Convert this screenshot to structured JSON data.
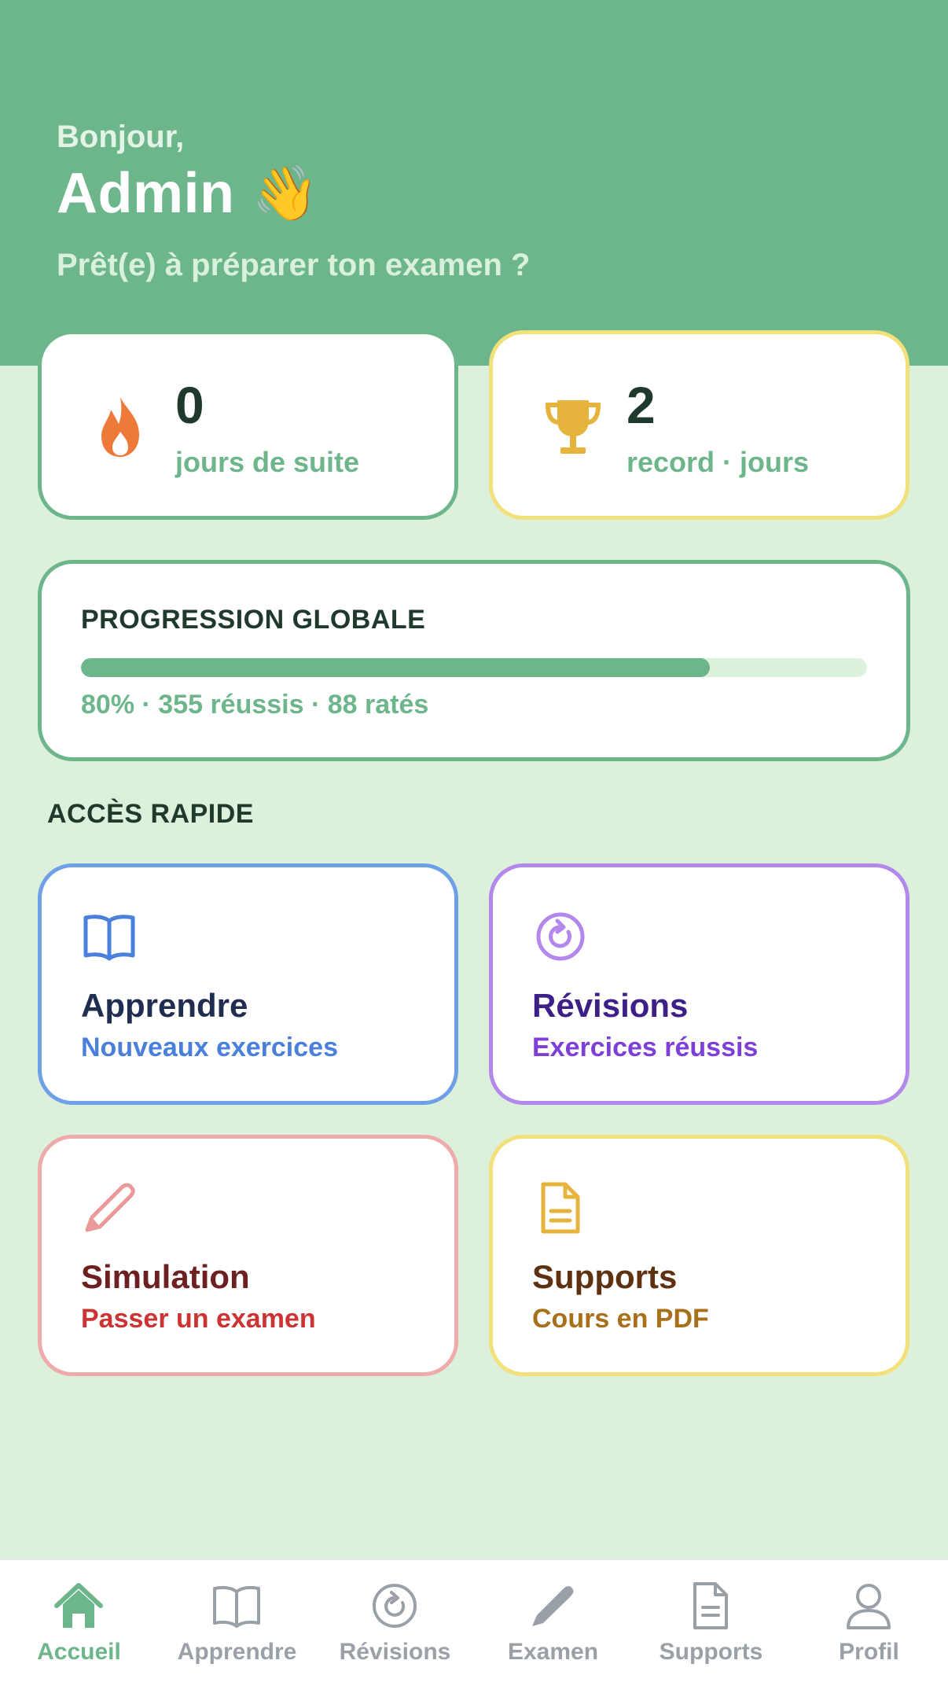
{
  "header": {
    "greeting": "Bonjour,",
    "username": "Admin",
    "wave_emoji": "👋",
    "subtitle": "Prêt(e) à préparer ton examen ?"
  },
  "stats": {
    "streak": {
      "value": "0",
      "label": "jours de suite",
      "icon": "flame-icon"
    },
    "record": {
      "value": "2",
      "label": "record · jours",
      "icon": "trophy-icon"
    }
  },
  "progress": {
    "title": "PROGRESSION GLOBALE",
    "percent": 80,
    "summary": "80% · 355 réussis · 88 ratés"
  },
  "quick_access": {
    "title": "ACCÈS RAPIDE",
    "items": [
      {
        "title": "Apprendre",
        "subtitle": "Nouveaux exercices",
        "icon": "book-icon",
        "color": "#6ea0e8"
      },
      {
        "title": "Révisions",
        "subtitle": "Exercices réussis",
        "icon": "refresh-icon",
        "color": "#b388ec"
      },
      {
        "title": "Simulation",
        "subtitle": "Passer un examen",
        "icon": "pencil-icon",
        "color": "#eeabab"
      },
      {
        "title": "Supports",
        "subtitle": "Cours en PDF",
        "icon": "document-icon",
        "color": "#f2e07a"
      }
    ]
  },
  "bottom_nav": {
    "active": "Accueil",
    "items": [
      {
        "label": "Accueil",
        "icon": "home-icon"
      },
      {
        "label": "Apprendre",
        "icon": "book-icon"
      },
      {
        "label": "Révisions",
        "icon": "refresh-icon"
      },
      {
        "label": "Examen",
        "icon": "pencil-icon"
      },
      {
        "label": "Supports",
        "icon": "document-icon"
      },
      {
        "label": "Profil",
        "icon": "user-icon"
      }
    ]
  },
  "colors": {
    "brand_green": "#6db58a",
    "background": "#dcf0dc",
    "inactive_nav": "#9aa0a8"
  }
}
